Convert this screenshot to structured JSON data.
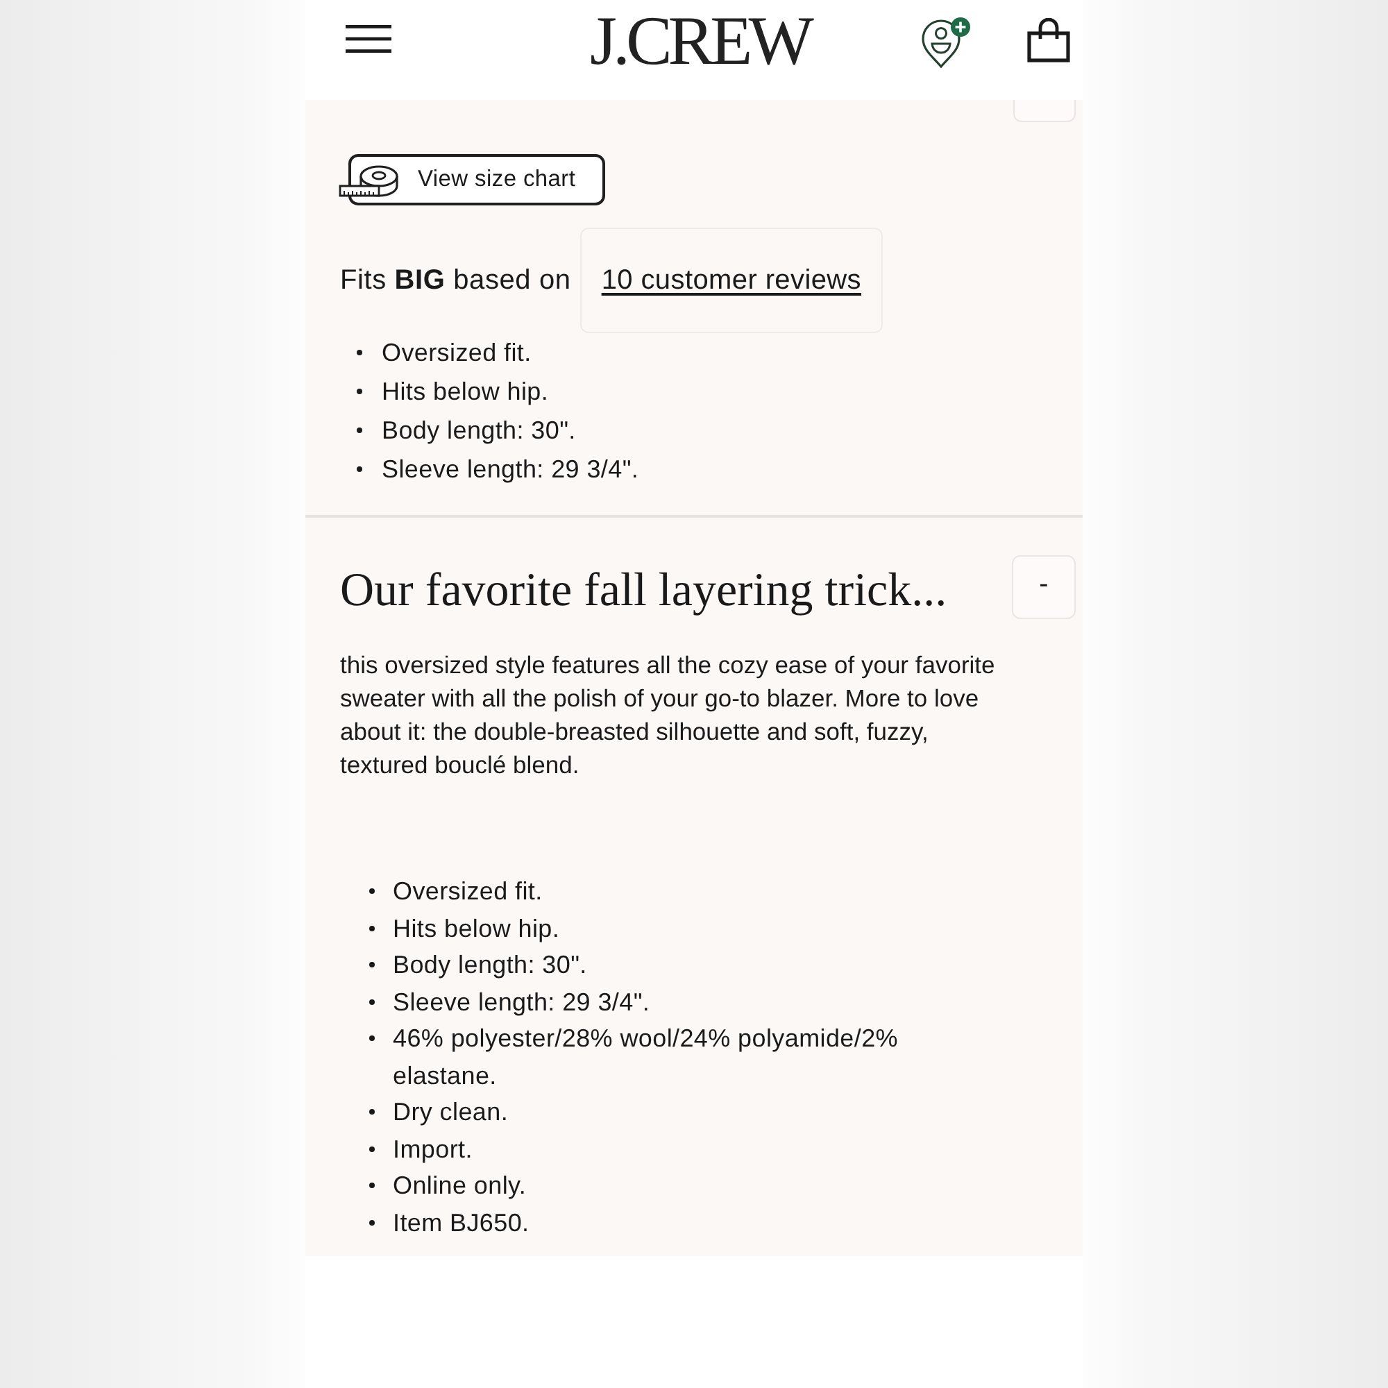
{
  "header": {
    "logo": "J.CREW"
  },
  "size_fit": {
    "size_chart_button": "View size chart",
    "fit_summary": "Fits **BIG** based on",
    "reviews_link": "10 customer reviews",
    "details": [
      "Oversized fit.",
      "Hits below hip.",
      "Body length: 30\".",
      "Sleeve length: 29 3/4\"."
    ]
  },
  "description": {
    "title": "Our favorite fall layering trick...",
    "toggle": "-",
    "expanded": true,
    "body": "this oversized style features all the cozy ease of your favorite sweater with all the polish of your go-to blazer. More to love about it: the double-breasted silhouette and soft, fuzzy, textured bouclé blend.",
    "details": [
      "Oversized fit.",
      "Hits below hip.",
      "Body length: 30\".",
      "Sleeve length: 29 3/4\".",
      "46% polyester/28% wool/24% polyamide/2% elastane.",
      "Dry clean.",
      "Import.",
      "Online only.",
      "Item BJ650."
    ]
  }
}
